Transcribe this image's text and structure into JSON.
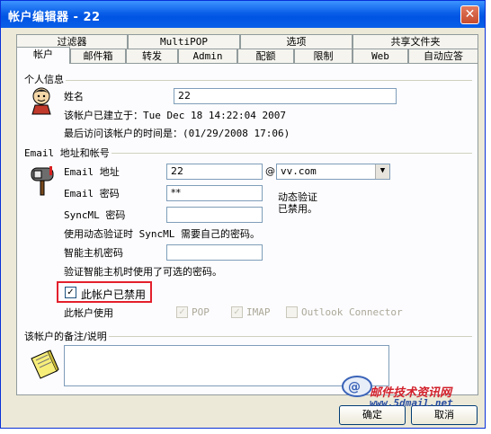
{
  "window": {
    "title": "帐户编辑器 - 22",
    "close": "✕"
  },
  "tabs_back": [
    {
      "label": "过滤器"
    },
    {
      "label": "MultiPOP"
    },
    {
      "label": "选项"
    },
    {
      "label": "共享文件夹"
    }
  ],
  "tabs_front": [
    {
      "label": "帐户",
      "active": true
    },
    {
      "label": "邮件箱"
    },
    {
      "label": "转发"
    },
    {
      "label": "Admin"
    },
    {
      "label": "配额"
    },
    {
      "label": "限制"
    },
    {
      "label": "Web"
    },
    {
      "label": "自动应答"
    }
  ],
  "personal": {
    "group_label": "个人信息",
    "name_label": "姓名",
    "name_value": "22",
    "created_text": "该帐户已建立于：Tue Dec 18 14:22:04 2007",
    "last_access_text": "最后访问该帐户的时间是：(01/29/2008 17:06)"
  },
  "email": {
    "group_label": "Email 地址和帐号",
    "address_label": "Email 地址",
    "address_value": "22",
    "at_sign": "@",
    "domain_value": "vv.com",
    "password_label": "Email 密码",
    "password_value": "**",
    "dynamic_auth_note": "动态验证\n已禁用。",
    "syncml_label": "SyncML 密码",
    "syncml_value": "",
    "syncml_note": "使用动态验证时 SyncML 需要自己的密码。",
    "smarthost_label": "智能主机密码",
    "smarthost_value": "",
    "smarthost_note": "验证智能主机时使用了可选的密码。",
    "disabled_label": "此帐户已禁用",
    "disabled_checked": true,
    "usage_label": "此帐户使用",
    "usage_options": [
      {
        "label": "POP",
        "checked": true
      },
      {
        "label": "IMAP",
        "checked": true
      },
      {
        "label": "Outlook Connector",
        "checked": false
      }
    ]
  },
  "notes": {
    "group_label": "该帐户的备注/说明",
    "value": ""
  },
  "buttons": {
    "ok": "确定",
    "cancel": "取消"
  },
  "watermark": {
    "line1": "邮件技术资讯网",
    "line2": "www.5dmail.net"
  },
  "icons": [
    "person-icon",
    "mailbox-icon",
    "note-icon",
    "watermark-logo-icon"
  ],
  "colors": {
    "titlebar": "#0054e3",
    "highlight": "#e3202c",
    "watermark": "#d2202a"
  }
}
